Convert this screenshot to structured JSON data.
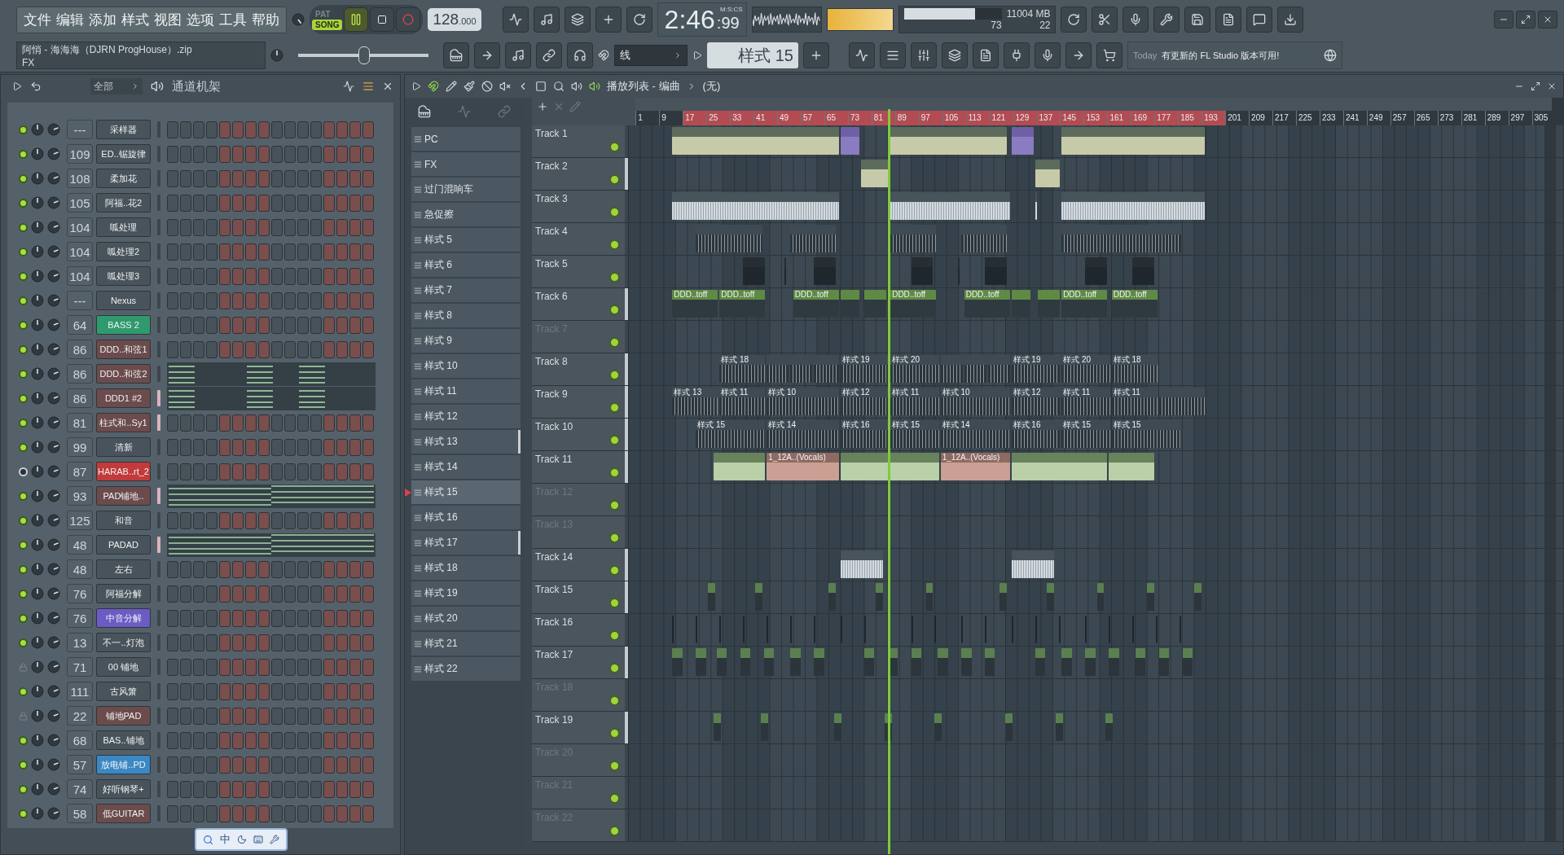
{
  "menu": [
    "文件",
    "编辑",
    "添加",
    "样式",
    "视图",
    "选项",
    "工具",
    "帮助"
  ],
  "project": {
    "title": "阿悄 - 海海海（DJRN ProgHouse）.zip",
    "subtitle": "FX"
  },
  "transport": {
    "modes": [
      {
        "label": "PAT",
        "selected": false
      },
      {
        "label": "SONG",
        "selected": true
      }
    ],
    "playing": true,
    "tempo": "128",
    "tempo_fraction": ".000"
  },
  "master_pitch": {
    "level": 0.5
  },
  "time": {
    "main": "2:46",
    "fraction": ":99",
    "unit": "M:S:CS"
  },
  "cpu": {
    "level": 0.73,
    "value": "73",
    "memory": "11004 MB",
    "polyphony": "22"
  },
  "snap": {
    "value": "线"
  },
  "pattern_selector": {
    "value": "样式 15"
  },
  "news": {
    "date": "Today",
    "message": "有更新的 FL Studio 版本可用!"
  },
  "channel_rack": {
    "filter": "全部",
    "title": "通道机架",
    "channels": [
      {
        "mixer": "---",
        "name": "采样器",
        "enabled": true,
        "locked": false,
        "selected": false,
        "kind": "steps"
      },
      {
        "mixer": "109",
        "name": "ED..锯旋律",
        "enabled": true,
        "locked": false,
        "selected": false,
        "kind": "steps"
      },
      {
        "mixer": "108",
        "name": "柔加花",
        "enabled": true,
        "locked": false,
        "selected": false,
        "kind": "steps"
      },
      {
        "mixer": "105",
        "name": "阿福..花2",
        "enabled": true,
        "locked": false,
        "selected": false,
        "kind": "steps"
      },
      {
        "mixer": "104",
        "name": "呱处理",
        "enabled": true,
        "locked": false,
        "selected": false,
        "kind": "steps"
      },
      {
        "mixer": "104",
        "name": "呱处理2",
        "enabled": true,
        "locked": false,
        "selected": false,
        "kind": "steps"
      },
      {
        "mixer": "104",
        "name": "呱处理3",
        "enabled": true,
        "locked": false,
        "selected": false,
        "kind": "steps"
      },
      {
        "mixer": "---",
        "name": "Nexus",
        "enabled": true,
        "locked": false,
        "selected": false,
        "kind": "steps"
      },
      {
        "mixer": "64",
        "name": "BASS 2",
        "enabled": true,
        "locked": false,
        "selected": false,
        "kind": "steps",
        "color": "#2f9a6e"
      },
      {
        "mixer": "86",
        "name": "DDD..和弦1",
        "enabled": true,
        "locked": false,
        "selected": false,
        "kind": "steps",
        "color": "#6b4b4c"
      },
      {
        "mixer": "86",
        "name": "DDD..和弦2",
        "enabled": true,
        "locked": false,
        "selected": false,
        "kind": "notes",
        "color": "#6b4b4c"
      },
      {
        "mixer": "86",
        "name": "DDD1 #2",
        "enabled": true,
        "locked": false,
        "selected": true,
        "kind": "notes",
        "color": "#6b4b4c"
      },
      {
        "mixer": "81",
        "name": "柱式和..Sy1",
        "enabled": true,
        "locked": false,
        "selected": true,
        "kind": "steps",
        "color": "#6b4b4c"
      },
      {
        "mixer": "99",
        "name": "清新",
        "enabled": true,
        "locked": false,
        "selected": false,
        "kind": "steps"
      },
      {
        "mixer": "87",
        "name": "HARAB..rt_2",
        "enabled": false,
        "locked": false,
        "selected": false,
        "kind": "steps",
        "color": "#c23a3a"
      },
      {
        "mixer": "93",
        "name": "PAD铺地..",
        "enabled": true,
        "locked": false,
        "selected": true,
        "kind": "sustain",
        "color": "#6b4b4c"
      },
      {
        "mixer": "125",
        "name": "和音",
        "enabled": true,
        "locked": false,
        "selected": false,
        "kind": "steps"
      },
      {
        "mixer": "48",
        "name": "PADAD",
        "enabled": true,
        "locked": false,
        "selected": true,
        "kind": "sustain"
      },
      {
        "mixer": "48",
        "name": "左右",
        "enabled": true,
        "locked": false,
        "selected": false,
        "kind": "steps"
      },
      {
        "mixer": "76",
        "name": "阿福分解",
        "enabled": true,
        "locked": false,
        "selected": false,
        "kind": "steps"
      },
      {
        "mixer": "76",
        "name": "中音分解",
        "enabled": true,
        "locked": false,
        "selected": false,
        "kind": "steps",
        "color": "#6a5cc4"
      },
      {
        "mixer": "13",
        "name": "不一..灯泡",
        "enabled": true,
        "locked": false,
        "selected": false,
        "kind": "steps"
      },
      {
        "mixer": "71",
        "name": "00 铺地",
        "locked": true,
        "selected": false,
        "kind": "steps"
      },
      {
        "mixer": "111",
        "name": "古风箫",
        "enabled": true,
        "locked": false,
        "selected": false,
        "kind": "steps"
      },
      {
        "mixer": "22",
        "name": "铺地PAD",
        "locked": true,
        "selected": false,
        "kind": "steps",
        "color": "#6b4b4c"
      },
      {
        "mixer": "68",
        "name": "BAS..铺地",
        "enabled": true,
        "locked": false,
        "selected": false,
        "kind": "steps"
      },
      {
        "mixer": "57",
        "name": "放电铺..PD",
        "enabled": true,
        "locked": false,
        "selected": false,
        "kind": "steps",
        "color": "#3a88c4"
      },
      {
        "mixer": "74",
        "name": "好听钢琴+",
        "enabled": true,
        "locked": false,
        "selected": false,
        "kind": "steps"
      },
      {
        "mixer": "58",
        "name": "低GUITAR",
        "enabled": true,
        "locked": false,
        "selected": false,
        "kind": "steps",
        "color": "#6b4b4c"
      }
    ]
  },
  "playlist": {
    "title": "播放列表 - 编曲",
    "arrangement": "(无)",
    "patterns": [
      {
        "label": "PC",
        "selected": false,
        "marked": false
      },
      {
        "label": "FX",
        "selected": false,
        "marked": false
      },
      {
        "label": "过门混响车",
        "selected": false,
        "marked": false
      },
      {
        "label": "急促擦",
        "selected": false,
        "marked": false
      },
      {
        "label": "样式 5",
        "selected": false,
        "marked": false
      },
      {
        "label": "样式 6",
        "selected": false,
        "marked": false
      },
      {
        "label": "样式 7",
        "selected": false,
        "marked": false
      },
      {
        "label": "样式 8",
        "selected": false,
        "marked": false
      },
      {
        "label": "样式 9",
        "selected": false,
        "marked": false
      },
      {
        "label": "样式 10",
        "selected": false,
        "marked": false
      },
      {
        "label": "样式 11",
        "selected": false,
        "marked": false
      },
      {
        "label": "样式 12",
        "selected": false,
        "marked": false
      },
      {
        "label": "样式 13",
        "selected": false,
        "marked": true
      },
      {
        "label": "样式 14",
        "selected": false,
        "marked": false
      },
      {
        "label": "样式 15",
        "selected": true,
        "marked": false
      },
      {
        "label": "样式 16",
        "selected": false,
        "marked": false
      },
      {
        "label": "样式 17",
        "selected": false,
        "marked": true
      },
      {
        "label": "样式 18",
        "selected": false,
        "marked": false
      },
      {
        "label": "样式 19",
        "selected": false,
        "marked": false
      },
      {
        "label": "样式 20",
        "selected": false,
        "marked": false
      },
      {
        "label": "样式 21",
        "selected": false,
        "marked": false
      },
      {
        "label": "样式 22",
        "selected": false,
        "marked": false
      }
    ],
    "ruler": [
      {
        "label": "1",
        "in_loop": false
      },
      {
        "label": "9",
        "in_loop": false
      },
      {
        "label": "17",
        "in_loop": true
      },
      {
        "label": "25",
        "in_loop": true
      },
      {
        "label": "33",
        "in_loop": true
      },
      {
        "label": "41",
        "in_loop": true
      },
      {
        "label": "49",
        "in_loop": true
      },
      {
        "label": "57",
        "in_loop": true
      },
      {
        "label": "65",
        "in_loop": true
      },
      {
        "label": "73",
        "in_loop": true
      },
      {
        "label": "81",
        "in_loop": true
      },
      {
        "label": "89",
        "in_loop": true
      },
      {
        "label": "97",
        "in_loop": true
      },
      {
        "label": "105",
        "in_loop": true
      },
      {
        "label": "113",
        "in_loop": true
      },
      {
        "label": "121",
        "in_loop": true
      },
      {
        "label": "129",
        "in_loop": true
      },
      {
        "label": "137",
        "in_loop": true
      },
      {
        "label": "145",
        "in_loop": true
      },
      {
        "label": "153",
        "in_loop": true
      },
      {
        "label": "161",
        "in_loop": true
      },
      {
        "label": "169",
        "in_loop": true
      },
      {
        "label": "177",
        "in_loop": true
      },
      {
        "label": "185",
        "in_loop": true
      },
      {
        "label": "193",
        "in_loop": true
      },
      {
        "label": "201",
        "in_loop": false
      },
      {
        "label": "209",
        "in_loop": false
      },
      {
        "label": "217",
        "in_loop": false
      },
      {
        "label": "225",
        "in_loop": false
      },
      {
        "label": "233",
        "in_loop": false
      },
      {
        "label": "241",
        "in_loop": false
      },
      {
        "label": "249",
        "in_loop": false
      },
      {
        "label": "257",
        "in_loop": false
      },
      {
        "label": "265",
        "in_loop": false
      },
      {
        "label": "273",
        "in_loop": false
      },
      {
        "label": "281",
        "in_loop": false
      },
      {
        "label": "289",
        "in_loop": false
      },
      {
        "label": "297",
        "in_loop": false
      },
      {
        "label": "305",
        "in_loop": false
      }
    ],
    "tracks": [
      {
        "name": "Track 1",
        "dimmed": false,
        "marked": false
      },
      {
        "name": "Track 2",
        "dimmed": false,
        "marked": true
      },
      {
        "name": "Track 3",
        "dimmed": false,
        "marked": false
      },
      {
        "name": "Track 4",
        "dimmed": false,
        "marked": false
      },
      {
        "name": "Track 5",
        "dimmed": false,
        "marked": false
      },
      {
        "name": "Track 6",
        "dimmed": false,
        "marked": true,
        "clips": [
          "DDD..toff",
          "DDD..toff",
          "DDD..toff",
          "DDD..toff",
          "DDD..toff",
          "DDD..toff",
          "DDD..toff"
        ]
      },
      {
        "name": "Track 7",
        "dimmed": true,
        "marked": false
      },
      {
        "name": "Track 8",
        "dimmed": false,
        "marked": true,
        "clips": [
          "样式 18",
          "样式 19",
          "样式 20",
          "样式 19",
          "样式 20",
          "样式 18"
        ]
      },
      {
        "name": "Track 9",
        "dimmed": false,
        "marked": true,
        "clips": [
          "样式 13",
          "样式 11",
          "样式 10",
          "样式 12",
          "样式 11",
          "样式 10",
          "样式 12",
          "样式 11",
          "样式 11"
        ]
      },
      {
        "name": "Track 10",
        "dimmed": false,
        "marked": true,
        "clips": [
          "样式 15",
          "样式 14",
          "样式 16",
          "样式 15",
          "样式 14",
          "样式 16",
          "样式 15",
          "样式 15"
        ]
      },
      {
        "name": "Track 11",
        "dimmed": false,
        "marked": true,
        "clips": [
          "1_12A..(Vocals)",
          "1_12A..(Vocals)"
        ]
      },
      {
        "name": "Track 12",
        "dimmed": true,
        "marked": false
      },
      {
        "name": "Track 13",
        "dimmed": true,
        "marked": false
      },
      {
        "name": "Track 14",
        "dimmed": false,
        "marked": true
      },
      {
        "name": "Track 15",
        "dimmed": false,
        "marked": true
      },
      {
        "name": "Track 16",
        "dimmed": false,
        "marked": false
      },
      {
        "name": "Track 17",
        "dimmed": false,
        "marked": true
      },
      {
        "name": "Track 18",
        "dimmed": true,
        "marked": false
      },
      {
        "name": "Track 19",
        "dimmed": false,
        "marked": true
      },
      {
        "name": "Track 20",
        "dimmed": true,
        "marked": false
      },
      {
        "name": "Track 21",
        "dimmed": true,
        "marked": false
      },
      {
        "name": "Track 22",
        "dimmed": true,
        "marked": false
      }
    ]
  },
  "ime_toolbar": {
    "label": "中"
  }
}
